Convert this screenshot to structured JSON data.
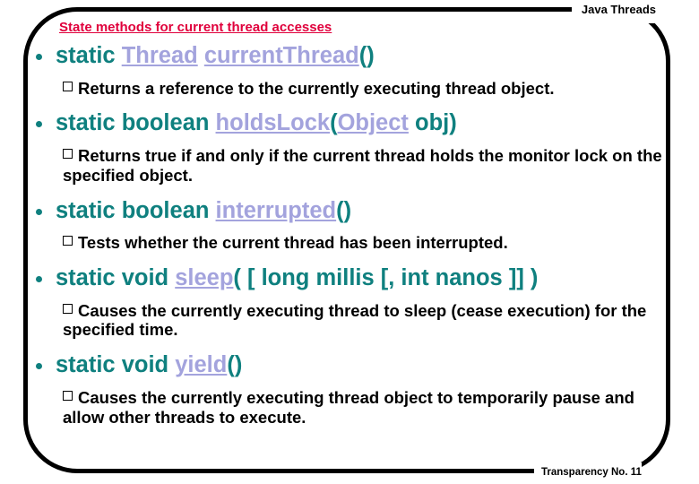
{
  "header": {
    "title": "Java Threads",
    "footer": "Transparency No. 11"
  },
  "slide": {
    "title": "State methods for current thread accesses",
    "title_color": "#e0003c",
    "signature_color": "#0f807f",
    "link_color": "#a3a3dd"
  },
  "bullets": [
    {
      "signature": {
        "parts": [
          {
            "text": "static ",
            "style": "plain"
          },
          {
            "text": "Thread",
            "style": "link"
          },
          {
            "text": " ",
            "style": "plain"
          },
          {
            "text": "currentThread",
            "style": "link"
          },
          {
            "text": "()",
            "style": "plain"
          }
        ]
      },
      "description": "Returns a reference to the currently executing thread object."
    },
    {
      "signature": {
        "parts": [
          {
            "text": "static boolean ",
            "style": "plain"
          },
          {
            "text": "holdsLock",
            "style": "link"
          },
          {
            "text": "(",
            "style": "plain"
          },
          {
            "text": "Object",
            "style": "link"
          },
          {
            "text": " obj)",
            "style": "plain"
          }
        ]
      },
      "description": "Returns true if and only if the current thread holds the monitor lock on the specified object."
    },
    {
      "signature": {
        "parts": [
          {
            "text": "static boolean ",
            "style": "plain"
          },
          {
            "text": "interrupted",
            "style": "link"
          },
          {
            "text": "()",
            "style": "plain"
          }
        ]
      },
      "description": "Tests whether the current thread has been interrupted."
    },
    {
      "signature": {
        "parts": [
          {
            "text": "static void ",
            "style": "plain"
          },
          {
            "text": "sleep",
            "style": "link"
          },
          {
            "text": "( [ long millis [, int nanos ]] )",
            "style": "plain"
          }
        ]
      },
      "description": "Causes the currently executing thread to sleep (cease execution) for the specified time."
    },
    {
      "signature": {
        "parts": [
          {
            "text": "static void ",
            "style": "plain"
          },
          {
            "text": "yield",
            "style": "link"
          },
          {
            "text": "()",
            "style": "plain"
          }
        ]
      },
      "description": "Causes the currently executing thread object to temporarily pause and allow other threads to execute."
    }
  ]
}
